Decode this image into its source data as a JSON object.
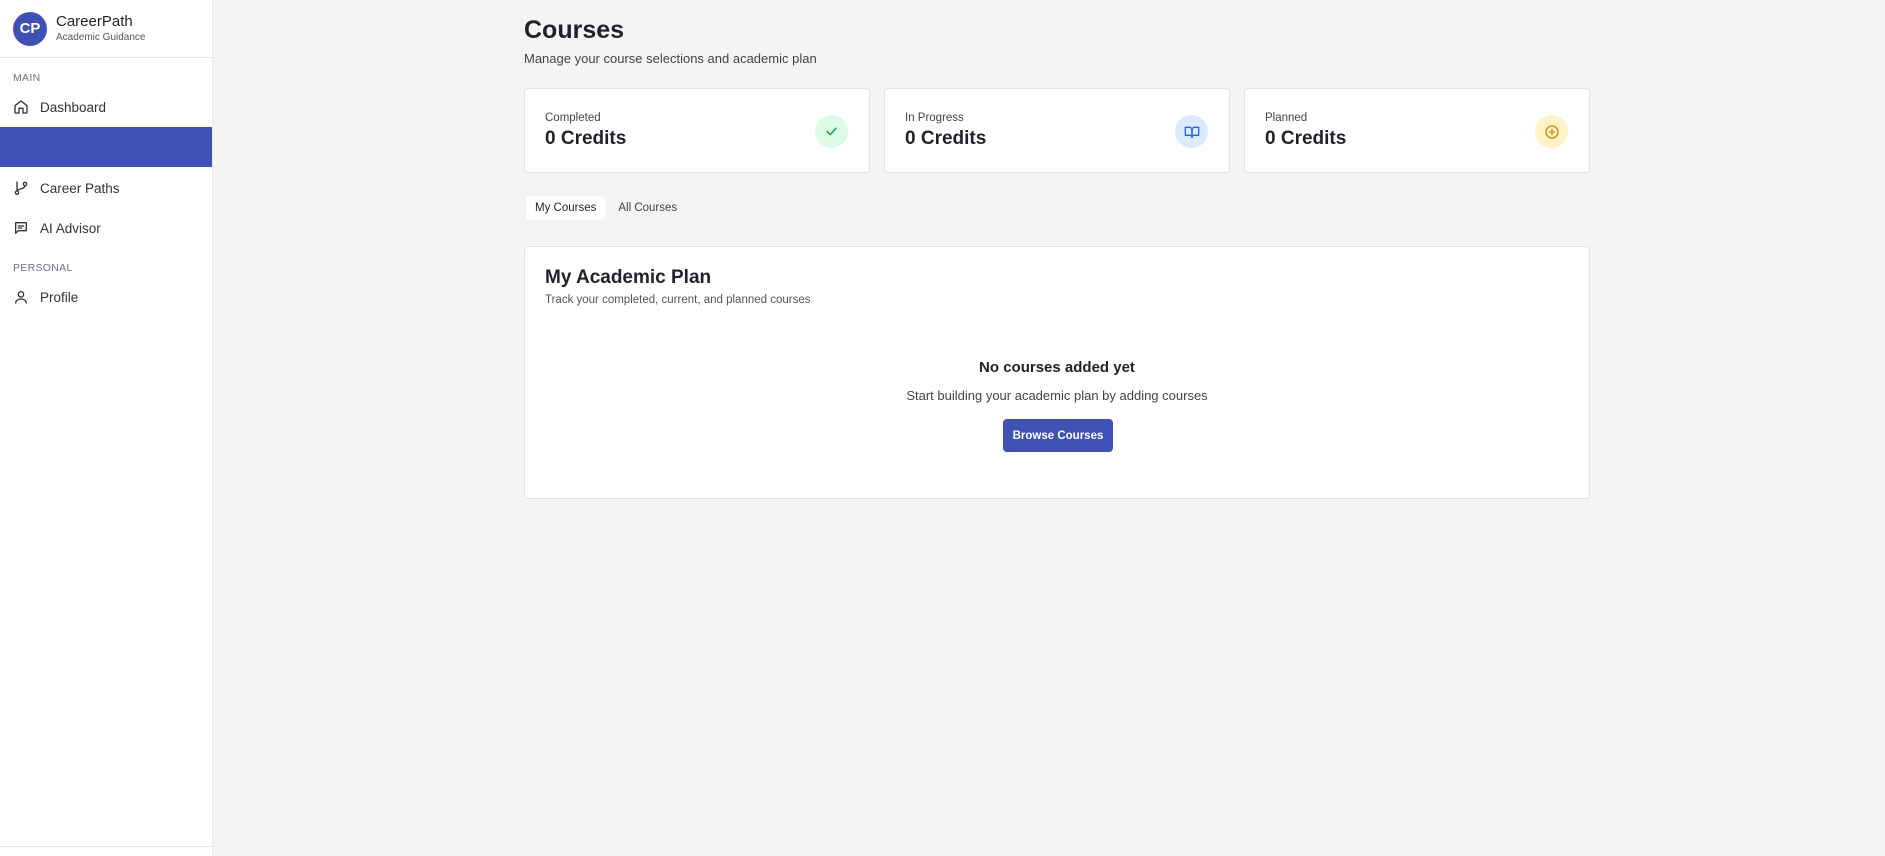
{
  "brand": {
    "logo_text": "CP",
    "name": "CareerPath",
    "subtitle": "Academic Guidance"
  },
  "sidebar": {
    "sections": [
      {
        "label": "MAIN"
      },
      {
        "label": "PERSONAL"
      }
    ],
    "items": [
      {
        "label": "Dashboard",
        "icon": "home-icon"
      },
      {
        "label": "",
        "icon": "",
        "active": true
      },
      {
        "label": "Career Paths",
        "icon": "git-branch-icon"
      },
      {
        "label": "AI Advisor",
        "icon": "message-icon"
      },
      {
        "label": "Profile",
        "icon": "user-icon"
      }
    ]
  },
  "page": {
    "title": "Courses",
    "subtitle": "Manage your course selections and academic plan"
  },
  "stats": [
    {
      "label": "Completed",
      "value": "0 Credits",
      "icon": "check-icon",
      "color": "#16a34a",
      "bg": "#dcfce7"
    },
    {
      "label": "In Progress",
      "value": "0 Credits",
      "icon": "book-open-icon",
      "color": "#2563eb",
      "bg": "#dbeafe"
    },
    {
      "label": "Planned",
      "value": "0 Credits",
      "icon": "plus-circle-icon",
      "color": "#ca8a04",
      "bg": "#fef3c7"
    }
  ],
  "tabs": [
    {
      "label": "My Courses",
      "active": true
    },
    {
      "label": "All Courses",
      "active": false
    }
  ],
  "plan": {
    "title": "My Academic Plan",
    "subtitle": "Track your completed, current, and planned courses",
    "empty_title": "No courses added yet",
    "empty_subtitle": "Start building your academic plan by adding courses",
    "button_label": "Browse Courses"
  },
  "colors": {
    "accent": "#3f51b5",
    "background": "#f4f4f4"
  }
}
